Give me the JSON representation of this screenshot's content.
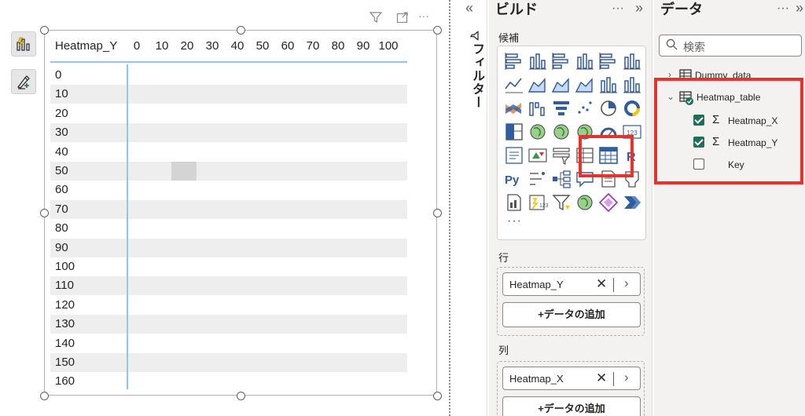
{
  "canvas": {
    "left_tools": [
      {
        "name": "build-visual-icon"
      },
      {
        "name": "format-visual-icon"
      }
    ],
    "visual_header": {
      "filter_icon": "filter-icon",
      "focus_icon": "focus-mode-icon",
      "more_label": "···"
    }
  },
  "matrix": {
    "corner_header": "Heatmap_Y",
    "columns": [
      "0",
      "10",
      "20",
      "30",
      "40",
      "50",
      "60",
      "70",
      "80",
      "90",
      "100"
    ],
    "rows": [
      "0",
      "10",
      "20",
      "30",
      "40",
      "50",
      "60",
      "70",
      "80",
      "90",
      "100",
      "110",
      "120",
      "130",
      "140",
      "150",
      "160"
    ],
    "highlight": {
      "row": "50",
      "column": "20",
      "color": "#d4d4d4"
    },
    "stripe_color": "#eeeeee",
    "line_color": "#91c4ef"
  },
  "filters": {
    "collapse_label": "«",
    "label": "フィルター",
    "icon": "filter-icon"
  },
  "build_pane": {
    "title": "ビルド",
    "more_label": "···",
    "expand_label": "»",
    "suggestions_label": "候補",
    "visual_icons": [
      "stacked-bar-chart-icon",
      "stacked-column-chart-icon",
      "clustered-bar-chart-icon",
      "clustered-column-chart-icon",
      "100-stacked-bar-chart-icon",
      "100-stacked-column-chart-icon",
      "line-chart-icon",
      "area-chart-icon",
      "stacked-area-chart-icon",
      "100-stacked-area-chart-icon",
      "line-and-stacked-column-chart-icon",
      "line-and-clustered-column-chart-icon",
      "ribbon-chart-icon",
      "waterfall-chart-icon",
      "funnel-chart-icon",
      "scatter-chart-icon",
      "pie-chart-icon",
      "donut-chart-icon",
      "treemap-icon",
      "map-icon",
      "filled-map-icon",
      "azure-map-icon",
      "gauge-icon",
      "card-icon",
      "multi-row-card-icon",
      "kpi-icon",
      "slicer-icon",
      "table-icon",
      "matrix-icon",
      "r-visual-icon",
      "python-visual-icon",
      "key-influencers-icon",
      "decomposition-tree-icon",
      "qna-icon",
      "smart-narrative-icon",
      "paginated-report-icon",
      "power-apps-icon",
      "power-automate-icon",
      "filter-visual-icon",
      "arcgis-map-icon",
      "power-apps-2-icon",
      "get-more-visuals-icon"
    ],
    "r_label": "R",
    "py_label": "Py",
    "card_label": "123",
    "more_visuals_label": "···",
    "rows_label": "行",
    "rows_field": "Heatmap_Y",
    "columns_label": "列",
    "columns_field": "Heatmap_X",
    "add_data_label": "+データの追加",
    "pill_remove": "✕",
    "pill_expand": "›"
  },
  "data_pane": {
    "title": "データ",
    "more_label": "···",
    "expand_label": "»",
    "search_placeholder": "検索",
    "tables": [
      {
        "name": "Dummy_data",
        "expanded": false
      },
      {
        "name": "Heatmap_table",
        "expanded": true
      }
    ],
    "fields": [
      {
        "name": "Heatmap_X",
        "checked": true,
        "sigma": true
      },
      {
        "name": "Heatmap_Y",
        "checked": true,
        "sigma": true
      },
      {
        "name": "Key",
        "checked": false,
        "sigma": false
      }
    ],
    "sigma_label": "Σ",
    "chevron_right": "›",
    "chevron_down": "⌄"
  },
  "colors": {
    "highlight_box": "#e8322c",
    "accent_check": "#1f6f5c"
  }
}
